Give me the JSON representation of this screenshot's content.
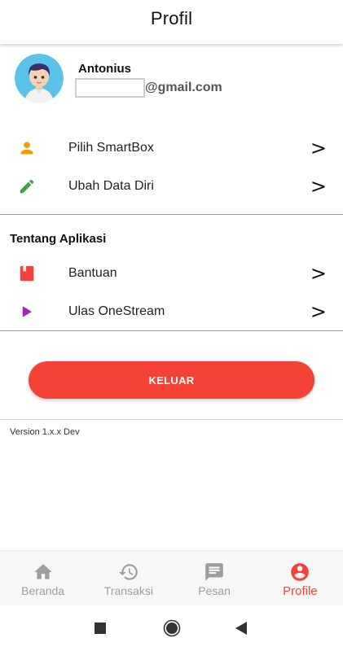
{
  "header": {
    "title": "Profil"
  },
  "profile": {
    "name": "Antonius",
    "email_domain": "@gmail.com",
    "avatar_icon": "user-avatar-illustration"
  },
  "menu_top": [
    {
      "label": "Pilih SmartBox",
      "icon": "person-icon",
      "icon_color": "#ff9800",
      "chevron": ">"
    },
    {
      "label": "Ubah Data Diri",
      "icon": "pencil-icon",
      "icon_color": "#43a047",
      "chevron": ">"
    }
  ],
  "about": {
    "title": "Tentang Aplikasi",
    "items": [
      {
        "label": "Bantuan",
        "icon": "book-icon",
        "icon_color": "#f44336",
        "chevron": ">"
      },
      {
        "label": "Ulas OneStream",
        "icon": "play-icon",
        "icon_color": "#9c27b0",
        "chevron": ">"
      }
    ]
  },
  "logout": {
    "label": "KELUAR",
    "color": "#f44336"
  },
  "version": "Version 1.x.x Dev",
  "bottom_nav": {
    "active": "Profile",
    "accent": "#f44336",
    "tabs": [
      {
        "label": "Beranda",
        "icon": "home-icon"
      },
      {
        "label": "Transaksi",
        "icon": "history-icon"
      },
      {
        "label": "Pesan",
        "icon": "message-icon"
      },
      {
        "label": "Profile",
        "icon": "account-circle-icon"
      }
    ]
  },
  "system_nav": {
    "buttons": [
      "recents-button",
      "home-button",
      "back-button"
    ]
  }
}
